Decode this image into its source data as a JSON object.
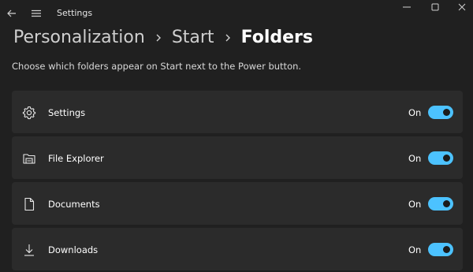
{
  "window": {
    "title": "Settings"
  },
  "breadcrumb": {
    "items": [
      "Personalization",
      "Start",
      "Folders"
    ],
    "separator_icon": "chevron-right-icon"
  },
  "subtitle": "Choose which folders appear on Start next to the Power button.",
  "folders": [
    {
      "label": "Settings",
      "icon": "gear-icon",
      "state": "On",
      "enabled": true
    },
    {
      "label": "File Explorer",
      "icon": "file-explorer-icon",
      "state": "On",
      "enabled": true
    },
    {
      "label": "Documents",
      "icon": "document-icon",
      "state": "On",
      "enabled": true
    },
    {
      "label": "Downloads",
      "icon": "download-icon",
      "state": "On",
      "enabled": true
    }
  ],
  "colors": {
    "background": "#202020",
    "card": "#2b2b2b",
    "accent": "#4cc2ff"
  }
}
